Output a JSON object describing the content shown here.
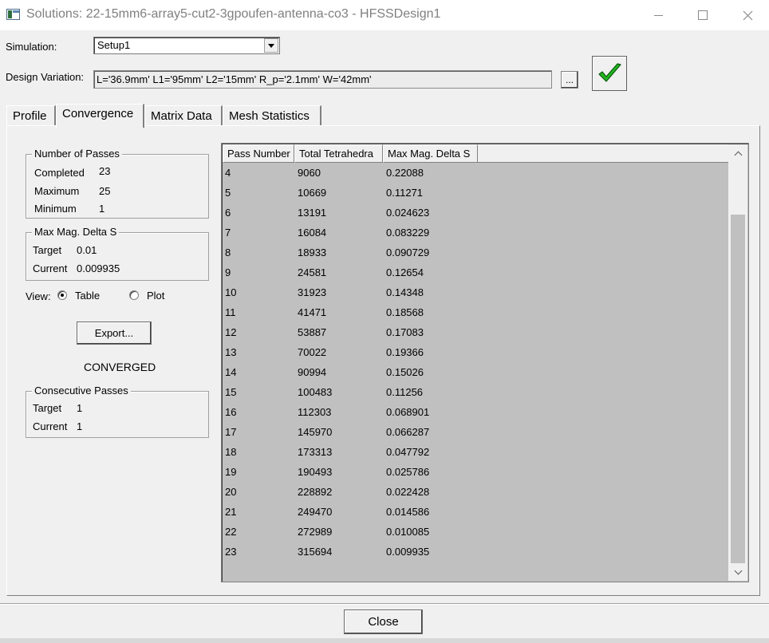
{
  "window": {
    "title": "Solutions: 22-15mm6-array5-cut2-3gpoufen-antenna-co3 - HFSSDesign1"
  },
  "simulation": {
    "label": "Simulation:",
    "value": "Setup1"
  },
  "design_variation": {
    "label": "Design Variation:",
    "value": "L='36.9mm' L1='95mm' L2='15mm' R_p='2.1mm' W='42mm'",
    "browse_label": "..."
  },
  "tabs": [
    {
      "label": "Profile"
    },
    {
      "label": "Convergence"
    },
    {
      "label": "Matrix Data"
    },
    {
      "label": "Mesh Statistics"
    }
  ],
  "active_tab": "Convergence",
  "passes": {
    "title": "Number of Passes",
    "completed_label": "Completed",
    "completed": "23",
    "maximum_label": "Maximum",
    "maximum": "25",
    "minimum_label": "Minimum",
    "minimum": "1"
  },
  "delta_s": {
    "title": "Max Mag. Delta S",
    "target_label": "Target",
    "target": "0.01",
    "current_label": "Current",
    "current": "0.009935"
  },
  "view": {
    "label": "View:",
    "table_label": "Table",
    "plot_label": "Plot",
    "selected": "Table"
  },
  "export_label": "Export...",
  "status": "CONVERGED",
  "consecutive": {
    "title": "Consecutive Passes",
    "target_label": "Target",
    "target": "1",
    "current_label": "Current",
    "current": "1"
  },
  "table": {
    "columns": [
      "Pass Number",
      "Total Tetrahedra",
      "Max Mag. Delta S"
    ],
    "rows": [
      [
        "4",
        "9060",
        "0.22088"
      ],
      [
        "5",
        "10669",
        "0.11271"
      ],
      [
        "6",
        "13191",
        "0.024623"
      ],
      [
        "7",
        "16084",
        "0.083229"
      ],
      [
        "8",
        "18933",
        "0.090729"
      ],
      [
        "9",
        "24581",
        "0.12654"
      ],
      [
        "10",
        "31923",
        "0.14348"
      ],
      [
        "11",
        "41471",
        "0.18568"
      ],
      [
        "12",
        "53887",
        "0.17083"
      ],
      [
        "13",
        "70022",
        "0.19366"
      ],
      [
        "14",
        "90994",
        "0.15026"
      ],
      [
        "15",
        "100483",
        "0.11256"
      ],
      [
        "16",
        "112303",
        "0.068901"
      ],
      [
        "17",
        "145970",
        "0.066287"
      ],
      [
        "18",
        "173313",
        "0.047792"
      ],
      [
        "19",
        "190493",
        "0.025786"
      ],
      [
        "20",
        "228892",
        "0.022428"
      ],
      [
        "21",
        "249470",
        "0.014586"
      ],
      [
        "22",
        "272989",
        "0.010085"
      ],
      [
        "23",
        "315694",
        "0.009935"
      ]
    ]
  },
  "close_label": "Close",
  "icons": {
    "app": "app-window-icon",
    "check": "green-check-icon",
    "minimize": "minimize-icon",
    "maximize": "maximize-icon",
    "close": "close-icon"
  },
  "colors": {
    "check_green": "#22b522",
    "table_bg": "#c0c0c0"
  }
}
